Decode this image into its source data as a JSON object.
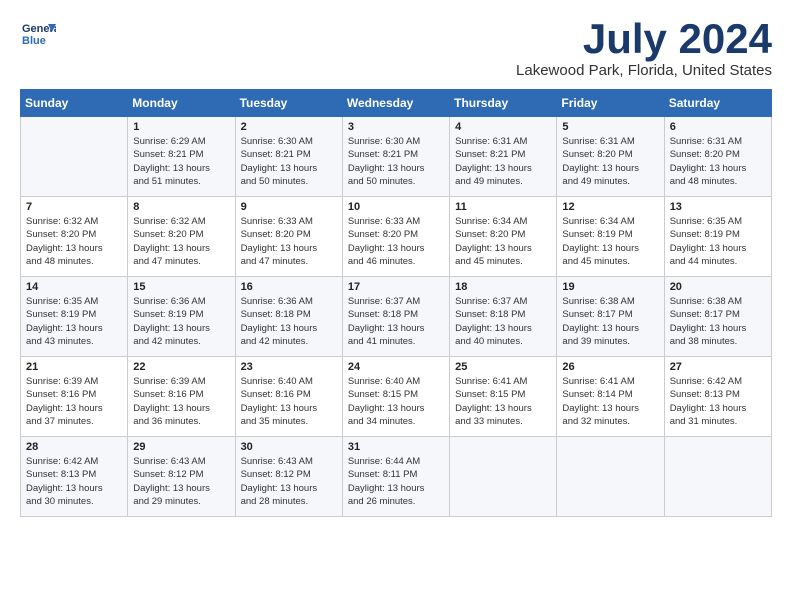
{
  "header": {
    "logo_line1": "General",
    "logo_line2": "Blue",
    "title": "July 2024",
    "subtitle": "Lakewood Park, Florida, United States"
  },
  "days_of_week": [
    "Sunday",
    "Monday",
    "Tuesday",
    "Wednesday",
    "Thursday",
    "Friday",
    "Saturday"
  ],
  "weeks": [
    [
      {
        "day": "",
        "info": ""
      },
      {
        "day": "1",
        "info": "Sunrise: 6:29 AM\nSunset: 8:21 PM\nDaylight: 13 hours\nand 51 minutes."
      },
      {
        "day": "2",
        "info": "Sunrise: 6:30 AM\nSunset: 8:21 PM\nDaylight: 13 hours\nand 50 minutes."
      },
      {
        "day": "3",
        "info": "Sunrise: 6:30 AM\nSunset: 8:21 PM\nDaylight: 13 hours\nand 50 minutes."
      },
      {
        "day": "4",
        "info": "Sunrise: 6:31 AM\nSunset: 8:21 PM\nDaylight: 13 hours\nand 49 minutes."
      },
      {
        "day": "5",
        "info": "Sunrise: 6:31 AM\nSunset: 8:20 PM\nDaylight: 13 hours\nand 49 minutes."
      },
      {
        "day": "6",
        "info": "Sunrise: 6:31 AM\nSunset: 8:20 PM\nDaylight: 13 hours\nand 48 minutes."
      }
    ],
    [
      {
        "day": "7",
        "info": "Sunrise: 6:32 AM\nSunset: 8:20 PM\nDaylight: 13 hours\nand 48 minutes."
      },
      {
        "day": "8",
        "info": "Sunrise: 6:32 AM\nSunset: 8:20 PM\nDaylight: 13 hours\nand 47 minutes."
      },
      {
        "day": "9",
        "info": "Sunrise: 6:33 AM\nSunset: 8:20 PM\nDaylight: 13 hours\nand 47 minutes."
      },
      {
        "day": "10",
        "info": "Sunrise: 6:33 AM\nSunset: 8:20 PM\nDaylight: 13 hours\nand 46 minutes."
      },
      {
        "day": "11",
        "info": "Sunrise: 6:34 AM\nSunset: 8:20 PM\nDaylight: 13 hours\nand 45 minutes."
      },
      {
        "day": "12",
        "info": "Sunrise: 6:34 AM\nSunset: 8:19 PM\nDaylight: 13 hours\nand 45 minutes."
      },
      {
        "day": "13",
        "info": "Sunrise: 6:35 AM\nSunset: 8:19 PM\nDaylight: 13 hours\nand 44 minutes."
      }
    ],
    [
      {
        "day": "14",
        "info": "Sunrise: 6:35 AM\nSunset: 8:19 PM\nDaylight: 13 hours\nand 43 minutes."
      },
      {
        "day": "15",
        "info": "Sunrise: 6:36 AM\nSunset: 8:19 PM\nDaylight: 13 hours\nand 42 minutes."
      },
      {
        "day": "16",
        "info": "Sunrise: 6:36 AM\nSunset: 8:18 PM\nDaylight: 13 hours\nand 42 minutes."
      },
      {
        "day": "17",
        "info": "Sunrise: 6:37 AM\nSunset: 8:18 PM\nDaylight: 13 hours\nand 41 minutes."
      },
      {
        "day": "18",
        "info": "Sunrise: 6:37 AM\nSunset: 8:18 PM\nDaylight: 13 hours\nand 40 minutes."
      },
      {
        "day": "19",
        "info": "Sunrise: 6:38 AM\nSunset: 8:17 PM\nDaylight: 13 hours\nand 39 minutes."
      },
      {
        "day": "20",
        "info": "Sunrise: 6:38 AM\nSunset: 8:17 PM\nDaylight: 13 hours\nand 38 minutes."
      }
    ],
    [
      {
        "day": "21",
        "info": "Sunrise: 6:39 AM\nSunset: 8:16 PM\nDaylight: 13 hours\nand 37 minutes."
      },
      {
        "day": "22",
        "info": "Sunrise: 6:39 AM\nSunset: 8:16 PM\nDaylight: 13 hours\nand 36 minutes."
      },
      {
        "day": "23",
        "info": "Sunrise: 6:40 AM\nSunset: 8:16 PM\nDaylight: 13 hours\nand 35 minutes."
      },
      {
        "day": "24",
        "info": "Sunrise: 6:40 AM\nSunset: 8:15 PM\nDaylight: 13 hours\nand 34 minutes."
      },
      {
        "day": "25",
        "info": "Sunrise: 6:41 AM\nSunset: 8:15 PM\nDaylight: 13 hours\nand 33 minutes."
      },
      {
        "day": "26",
        "info": "Sunrise: 6:41 AM\nSunset: 8:14 PM\nDaylight: 13 hours\nand 32 minutes."
      },
      {
        "day": "27",
        "info": "Sunrise: 6:42 AM\nSunset: 8:13 PM\nDaylight: 13 hours\nand 31 minutes."
      }
    ],
    [
      {
        "day": "28",
        "info": "Sunrise: 6:42 AM\nSunset: 8:13 PM\nDaylight: 13 hours\nand 30 minutes."
      },
      {
        "day": "29",
        "info": "Sunrise: 6:43 AM\nSunset: 8:12 PM\nDaylight: 13 hours\nand 29 minutes."
      },
      {
        "day": "30",
        "info": "Sunrise: 6:43 AM\nSunset: 8:12 PM\nDaylight: 13 hours\nand 28 minutes."
      },
      {
        "day": "31",
        "info": "Sunrise: 6:44 AM\nSunset: 8:11 PM\nDaylight: 13 hours\nand 26 minutes."
      },
      {
        "day": "",
        "info": ""
      },
      {
        "day": "",
        "info": ""
      },
      {
        "day": "",
        "info": ""
      }
    ]
  ]
}
